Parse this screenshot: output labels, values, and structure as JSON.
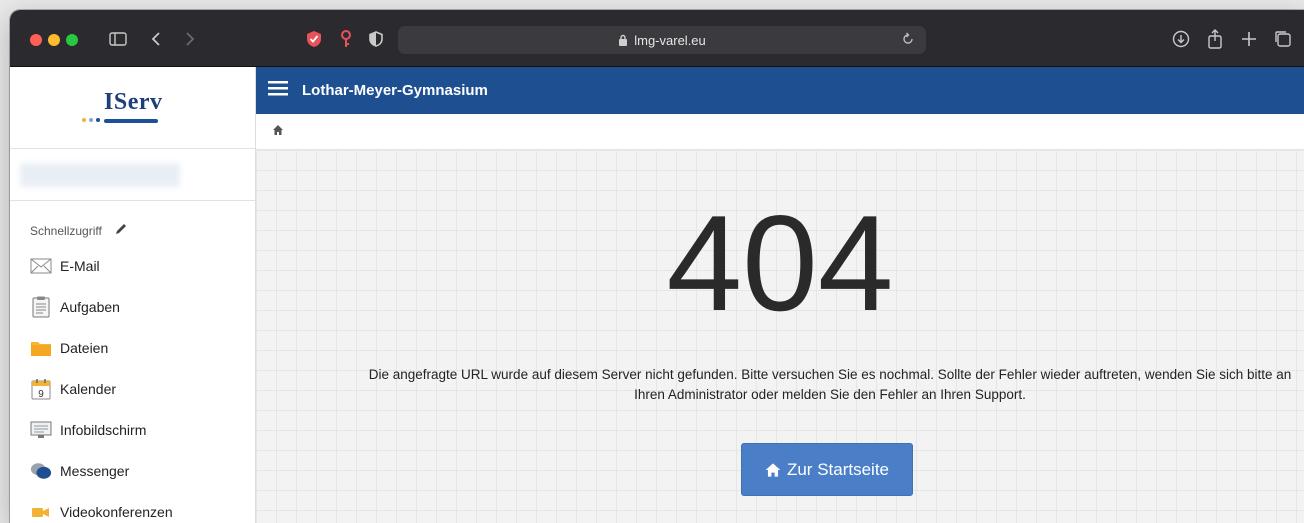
{
  "browser": {
    "url": "lmg-varel.eu",
    "colors": {
      "toolbar": "#2b2a2e",
      "close": "#ff5f57",
      "minimize": "#febc2e",
      "zoom": "#28c840"
    }
  },
  "sidebar": {
    "logo_text": "IServ",
    "quick_access_label": "Schnellzugriff",
    "items": [
      {
        "label": "E-Mail",
        "icon": "mail-icon"
      },
      {
        "label": "Aufgaben",
        "icon": "clipboard-icon"
      },
      {
        "label": "Dateien",
        "icon": "folder-icon"
      },
      {
        "label": "Kalender",
        "icon": "calendar-icon",
        "badge": "9"
      },
      {
        "label": "Infobildschirm",
        "icon": "monitor-icon"
      },
      {
        "label": "Messenger",
        "icon": "chat-icon"
      },
      {
        "label": "Videokonferenzen",
        "icon": "video-icon"
      }
    ]
  },
  "header": {
    "title": "Lothar-Meyer-Gymnasium",
    "color": "#1e4f91"
  },
  "error": {
    "code": "404",
    "message": "Die angefragte URL wurde auf diesem Server nicht gefunden. Bitte versuchen Sie es nochmal. Sollte der Fehler wieder auftreten, wenden Sie sich bitte an Ihren Administrator oder melden Sie den Fehler an Ihren Support.",
    "button_label": "Zur Startseite",
    "button_color": "#4a7fc8"
  }
}
